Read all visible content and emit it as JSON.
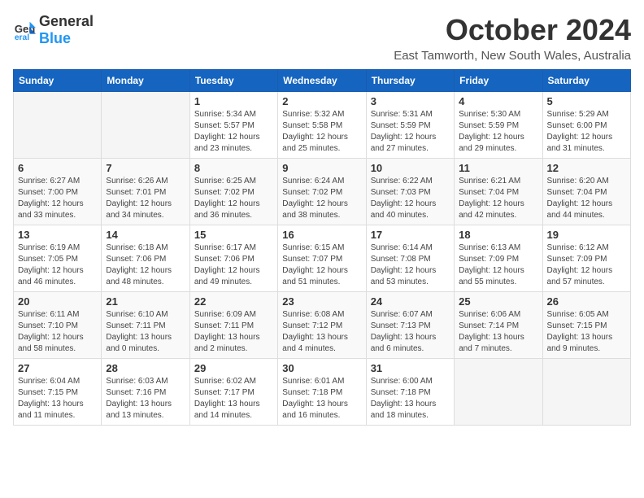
{
  "app": {
    "name_general": "General",
    "name_blue": "Blue"
  },
  "header": {
    "month": "October 2024",
    "location": "East Tamworth, New South Wales, Australia"
  },
  "weekdays": [
    "Sunday",
    "Monday",
    "Tuesday",
    "Wednesday",
    "Thursday",
    "Friday",
    "Saturday"
  ],
  "weeks": [
    [
      {
        "day": "",
        "sunrise": "",
        "sunset": "",
        "daylight": ""
      },
      {
        "day": "",
        "sunrise": "",
        "sunset": "",
        "daylight": ""
      },
      {
        "day": "1",
        "sunrise": "Sunrise: 5:34 AM",
        "sunset": "Sunset: 5:57 PM",
        "daylight": "Daylight: 12 hours and 23 minutes."
      },
      {
        "day": "2",
        "sunrise": "Sunrise: 5:32 AM",
        "sunset": "Sunset: 5:58 PM",
        "daylight": "Daylight: 12 hours and 25 minutes."
      },
      {
        "day": "3",
        "sunrise": "Sunrise: 5:31 AM",
        "sunset": "Sunset: 5:59 PM",
        "daylight": "Daylight: 12 hours and 27 minutes."
      },
      {
        "day": "4",
        "sunrise": "Sunrise: 5:30 AM",
        "sunset": "Sunset: 5:59 PM",
        "daylight": "Daylight: 12 hours and 29 minutes."
      },
      {
        "day": "5",
        "sunrise": "Sunrise: 5:29 AM",
        "sunset": "Sunset: 6:00 PM",
        "daylight": "Daylight: 12 hours and 31 minutes."
      }
    ],
    [
      {
        "day": "6",
        "sunrise": "Sunrise: 6:27 AM",
        "sunset": "Sunset: 7:00 PM",
        "daylight": "Daylight: 12 hours and 33 minutes."
      },
      {
        "day": "7",
        "sunrise": "Sunrise: 6:26 AM",
        "sunset": "Sunset: 7:01 PM",
        "daylight": "Daylight: 12 hours and 34 minutes."
      },
      {
        "day": "8",
        "sunrise": "Sunrise: 6:25 AM",
        "sunset": "Sunset: 7:02 PM",
        "daylight": "Daylight: 12 hours and 36 minutes."
      },
      {
        "day": "9",
        "sunrise": "Sunrise: 6:24 AM",
        "sunset": "Sunset: 7:02 PM",
        "daylight": "Daylight: 12 hours and 38 minutes."
      },
      {
        "day": "10",
        "sunrise": "Sunrise: 6:22 AM",
        "sunset": "Sunset: 7:03 PM",
        "daylight": "Daylight: 12 hours and 40 minutes."
      },
      {
        "day": "11",
        "sunrise": "Sunrise: 6:21 AM",
        "sunset": "Sunset: 7:04 PM",
        "daylight": "Daylight: 12 hours and 42 minutes."
      },
      {
        "day": "12",
        "sunrise": "Sunrise: 6:20 AM",
        "sunset": "Sunset: 7:04 PM",
        "daylight": "Daylight: 12 hours and 44 minutes."
      }
    ],
    [
      {
        "day": "13",
        "sunrise": "Sunrise: 6:19 AM",
        "sunset": "Sunset: 7:05 PM",
        "daylight": "Daylight: 12 hours and 46 minutes."
      },
      {
        "day": "14",
        "sunrise": "Sunrise: 6:18 AM",
        "sunset": "Sunset: 7:06 PM",
        "daylight": "Daylight: 12 hours and 48 minutes."
      },
      {
        "day": "15",
        "sunrise": "Sunrise: 6:17 AM",
        "sunset": "Sunset: 7:06 PM",
        "daylight": "Daylight: 12 hours and 49 minutes."
      },
      {
        "day": "16",
        "sunrise": "Sunrise: 6:15 AM",
        "sunset": "Sunset: 7:07 PM",
        "daylight": "Daylight: 12 hours and 51 minutes."
      },
      {
        "day": "17",
        "sunrise": "Sunrise: 6:14 AM",
        "sunset": "Sunset: 7:08 PM",
        "daylight": "Daylight: 12 hours and 53 minutes."
      },
      {
        "day": "18",
        "sunrise": "Sunrise: 6:13 AM",
        "sunset": "Sunset: 7:09 PM",
        "daylight": "Daylight: 12 hours and 55 minutes."
      },
      {
        "day": "19",
        "sunrise": "Sunrise: 6:12 AM",
        "sunset": "Sunset: 7:09 PM",
        "daylight": "Daylight: 12 hours and 57 minutes."
      }
    ],
    [
      {
        "day": "20",
        "sunrise": "Sunrise: 6:11 AM",
        "sunset": "Sunset: 7:10 PM",
        "daylight": "Daylight: 12 hours and 58 minutes."
      },
      {
        "day": "21",
        "sunrise": "Sunrise: 6:10 AM",
        "sunset": "Sunset: 7:11 PM",
        "daylight": "Daylight: 13 hours and 0 minutes."
      },
      {
        "day": "22",
        "sunrise": "Sunrise: 6:09 AM",
        "sunset": "Sunset: 7:11 PM",
        "daylight": "Daylight: 13 hours and 2 minutes."
      },
      {
        "day": "23",
        "sunrise": "Sunrise: 6:08 AM",
        "sunset": "Sunset: 7:12 PM",
        "daylight": "Daylight: 13 hours and 4 minutes."
      },
      {
        "day": "24",
        "sunrise": "Sunrise: 6:07 AM",
        "sunset": "Sunset: 7:13 PM",
        "daylight": "Daylight: 13 hours and 6 minutes."
      },
      {
        "day": "25",
        "sunrise": "Sunrise: 6:06 AM",
        "sunset": "Sunset: 7:14 PM",
        "daylight": "Daylight: 13 hours and 7 minutes."
      },
      {
        "day": "26",
        "sunrise": "Sunrise: 6:05 AM",
        "sunset": "Sunset: 7:15 PM",
        "daylight": "Daylight: 13 hours and 9 minutes."
      }
    ],
    [
      {
        "day": "27",
        "sunrise": "Sunrise: 6:04 AM",
        "sunset": "Sunset: 7:15 PM",
        "daylight": "Daylight: 13 hours and 11 minutes."
      },
      {
        "day": "28",
        "sunrise": "Sunrise: 6:03 AM",
        "sunset": "Sunset: 7:16 PM",
        "daylight": "Daylight: 13 hours and 13 minutes."
      },
      {
        "day": "29",
        "sunrise": "Sunrise: 6:02 AM",
        "sunset": "Sunset: 7:17 PM",
        "daylight": "Daylight: 13 hours and 14 minutes."
      },
      {
        "day": "30",
        "sunrise": "Sunrise: 6:01 AM",
        "sunset": "Sunset: 7:18 PM",
        "daylight": "Daylight: 13 hours and 16 minutes."
      },
      {
        "day": "31",
        "sunrise": "Sunrise: 6:00 AM",
        "sunset": "Sunset: 7:18 PM",
        "daylight": "Daylight: 13 hours and 18 minutes."
      },
      {
        "day": "",
        "sunrise": "",
        "sunset": "",
        "daylight": ""
      },
      {
        "day": "",
        "sunrise": "",
        "sunset": "",
        "daylight": ""
      }
    ]
  ]
}
